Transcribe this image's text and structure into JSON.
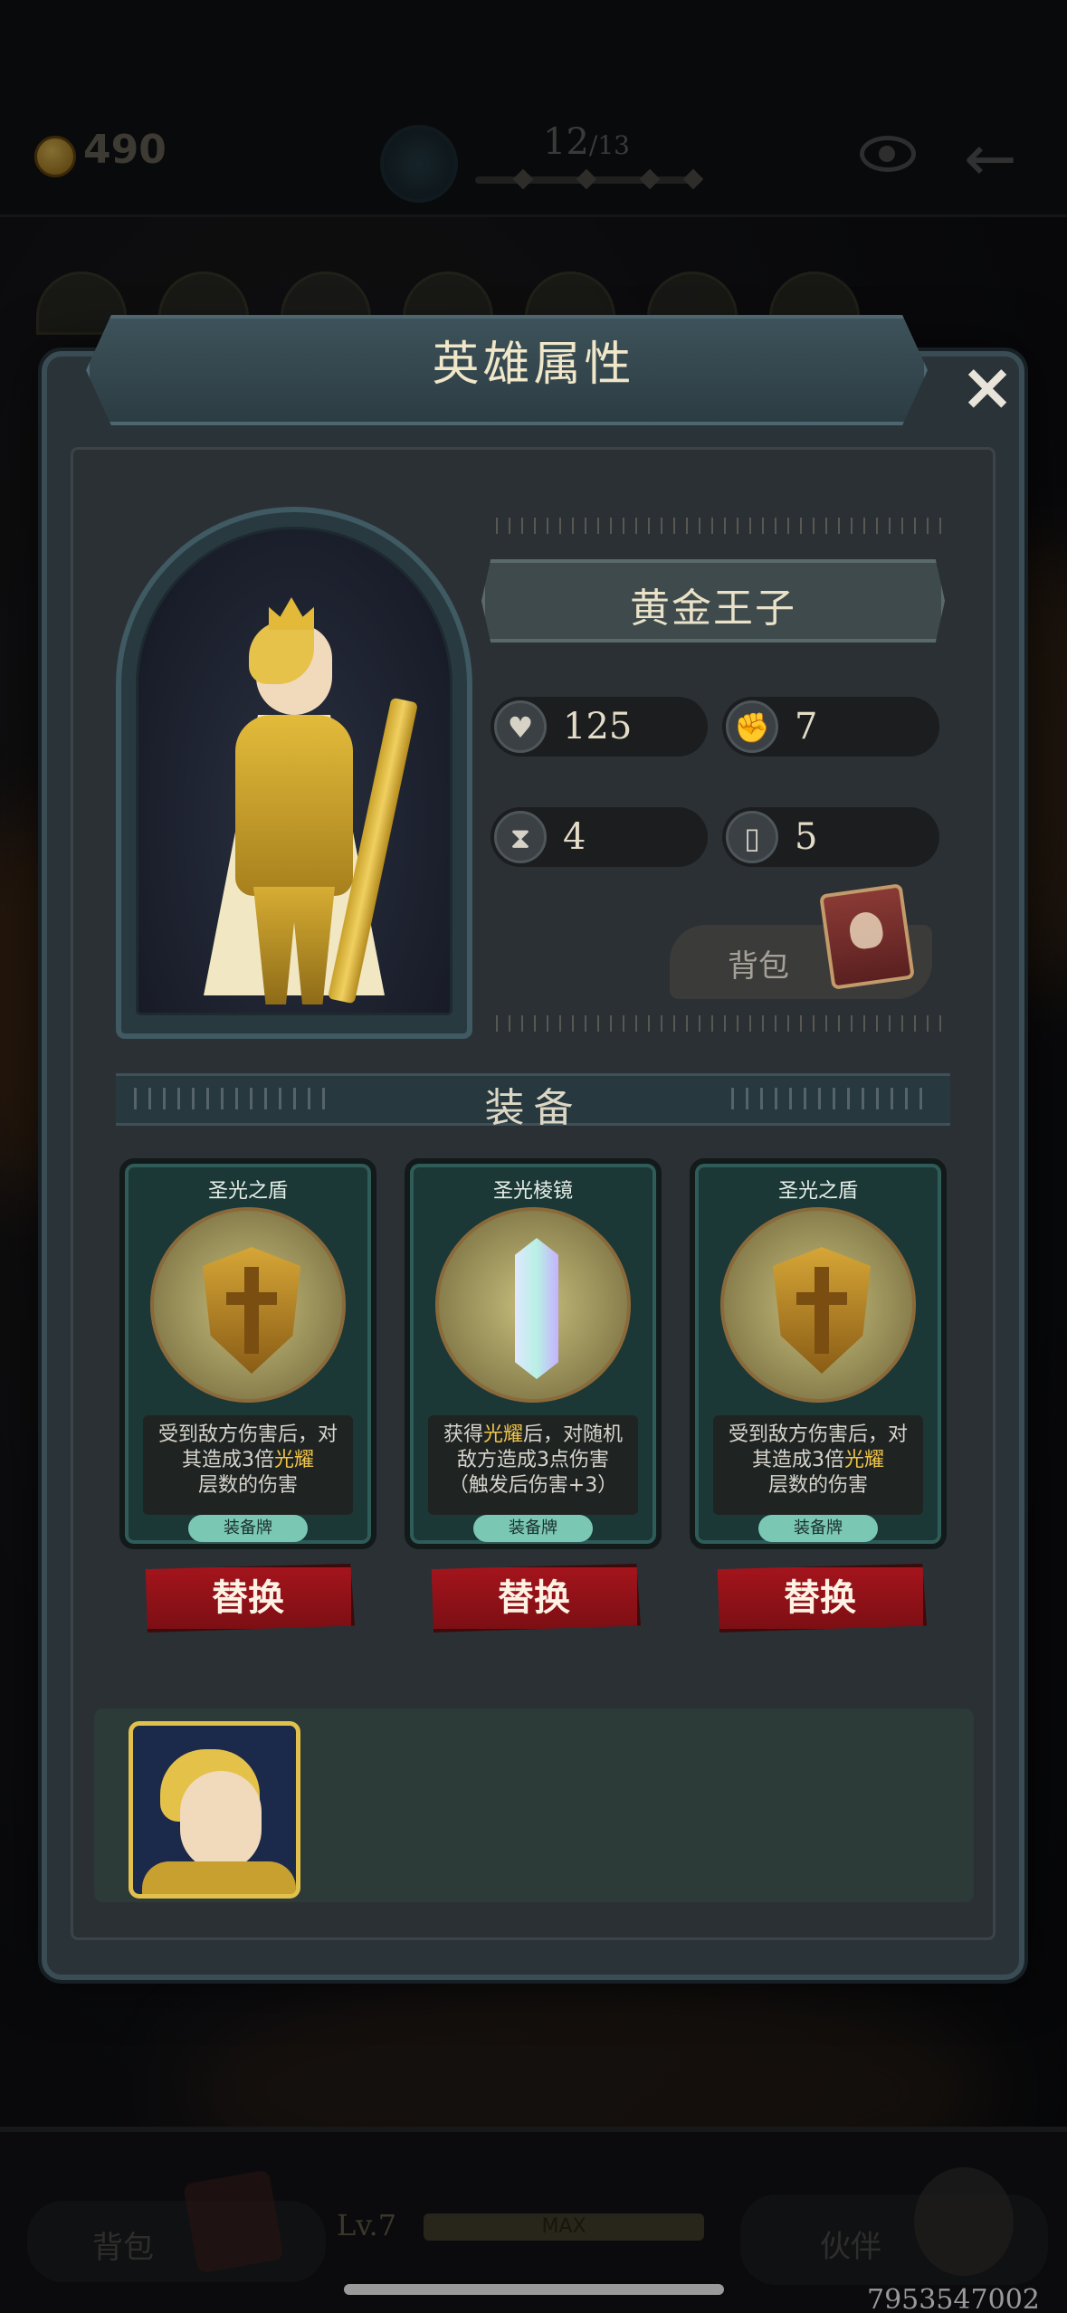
{
  "top_bar": {
    "coins": "490",
    "progress_current": "12",
    "progress_total": "/13"
  },
  "dialog": {
    "title": "英雄属性",
    "close_label": "×",
    "hero_name": "黄金王子",
    "stats": {
      "hp": "125",
      "power": "7",
      "energy": "4",
      "cards": "5"
    },
    "bag_label": "背包",
    "equipment_title": "装备",
    "cards": [
      {
        "name": "圣光之盾",
        "desc_1": "受到敌方伤害后，对",
        "desc_2a": "其造成3倍",
        "desc_2b": "光耀",
        "desc_3": "层数的伤害",
        "tag": "装备牌",
        "art": "shield"
      },
      {
        "name": "圣光棱镜",
        "desc_1a": "获得",
        "desc_1b": "光耀",
        "desc_1c": "后，对随机",
        "desc_2": "敌方造成3点伤害",
        "desc_3": "（触发后伤害+3）",
        "tag": "装备牌",
        "art": "crystal"
      },
      {
        "name": "圣光之盾",
        "desc_1": "受到敌方伤害后，对",
        "desc_2a": "其造成3倍",
        "desc_2b": "光耀",
        "desc_3": "层数的伤害",
        "tag": "装备牌",
        "art": "shield"
      }
    ],
    "replace_label": "替换"
  },
  "bottom_bar": {
    "bag_label": "背包",
    "level": "Lv.7",
    "max_label": "MAX",
    "partner_label": "伙伴"
  },
  "footer_code": "7953547002",
  "colors": {
    "accent_gold": "#f0c44a",
    "replace_red": "#a4141c",
    "card_teal": "#1b3836",
    "tag_mint": "#7ac7b4"
  }
}
